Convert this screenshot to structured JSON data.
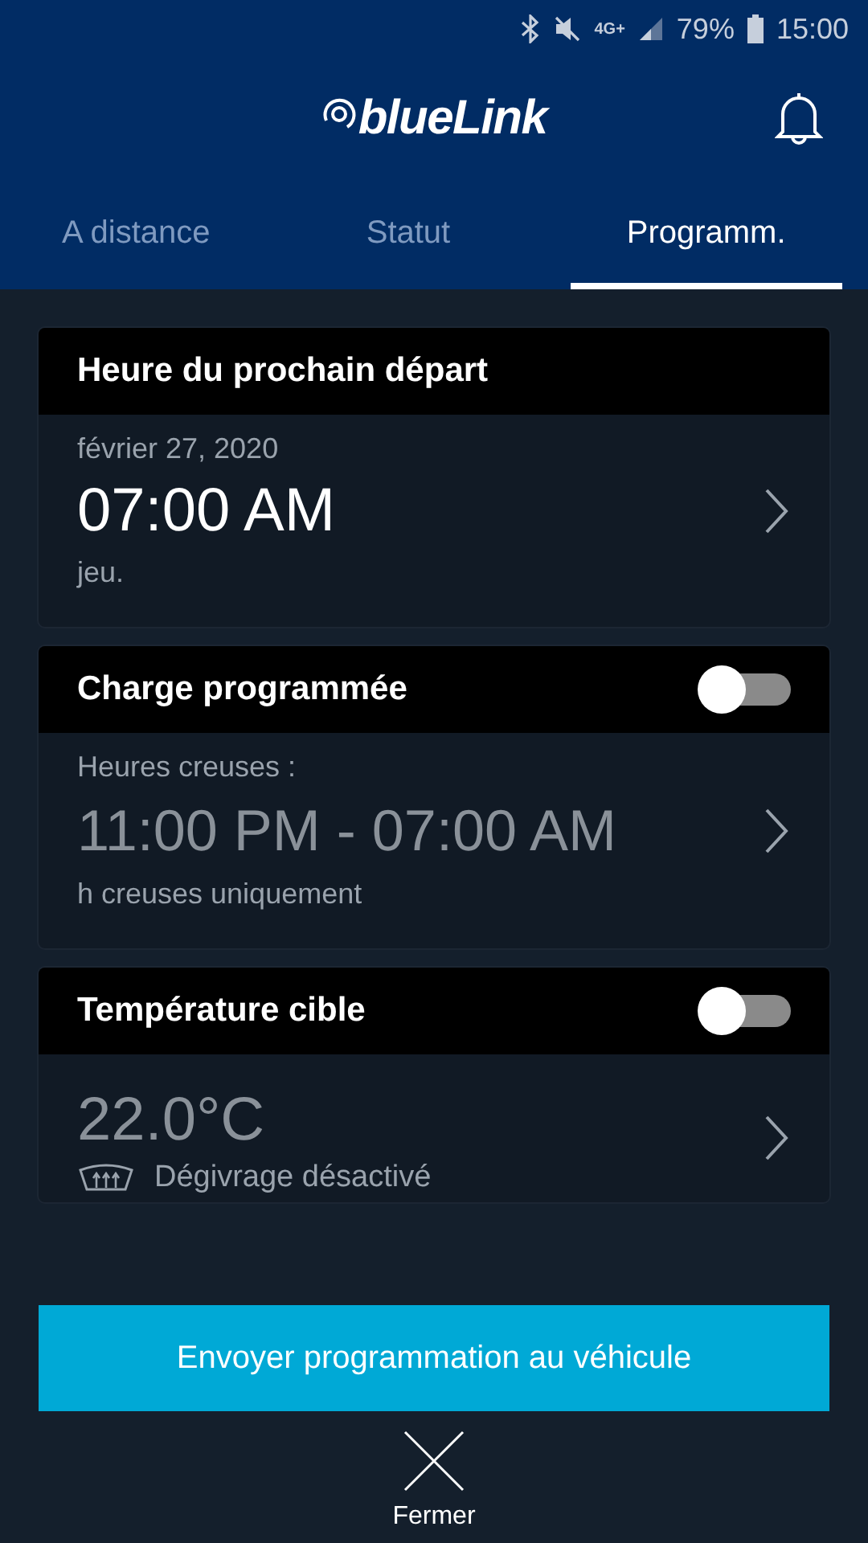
{
  "status_bar": {
    "network": "4G+",
    "battery": "79%",
    "time": "15:00"
  },
  "header": {
    "logo": "blueLink"
  },
  "tabs": [
    {
      "label": "A distance",
      "selected": false
    },
    {
      "label": "Statut",
      "selected": false
    },
    {
      "label": "Programm.",
      "selected": true
    }
  ],
  "cards": [
    {
      "kind": "departure",
      "title": "Heure du prochain départ",
      "date": "février 27, 2020",
      "time": "07:00 AM",
      "day": "jeu."
    },
    {
      "kind": "charge",
      "title": "Charge programmée",
      "on": false,
      "label": "Heures creuses :",
      "range": "11:00 PM - 07:00 AM",
      "note": "h creuses uniquement"
    },
    {
      "kind": "temperature",
      "title": "Température cible",
      "on": false,
      "temperature": "22.0°C",
      "defrost": "Dégivrage désactivé"
    }
  ],
  "send_button": "Envoyer programmation au véhicule",
  "close_button": "Fermer"
}
